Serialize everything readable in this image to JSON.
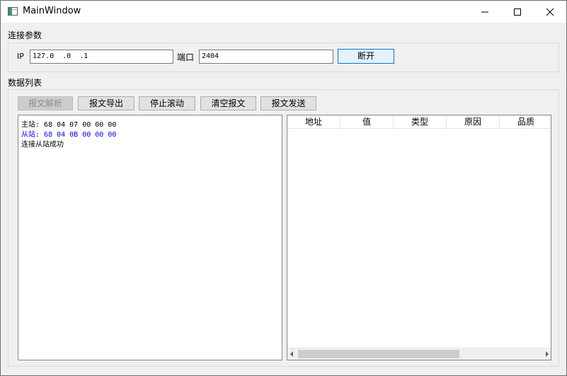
{
  "window": {
    "title": "MainWindow",
    "controls": {
      "minimize": "minimize",
      "maximize": "maximize",
      "close": "close"
    }
  },
  "connection": {
    "section_label": "连接参数",
    "ip_label": "IP",
    "ip_value": "127.0  .0  .1",
    "port_label": "端口",
    "port_value": "2404",
    "disconnect_label": "断开"
  },
  "data_list": {
    "section_label": "数据列表",
    "buttons": {
      "parse": "报文解析",
      "export": "报文导出",
      "stop_scroll": "停止滚动",
      "clear": "清空报文",
      "send": "报文发送"
    },
    "log": {
      "lines": [
        {
          "text": "主站: 68 04 07 00 00 00",
          "color": "#000000"
        },
        {
          "text": "从站: 68 04 0B 00 00 00",
          "color": "#0000ff"
        },
        {
          "text": "连接从站成功",
          "color": "#000000"
        }
      ]
    },
    "table": {
      "columns": [
        "地址",
        "值",
        "类型",
        "原因",
        "品质"
      ],
      "rows": []
    }
  }
}
